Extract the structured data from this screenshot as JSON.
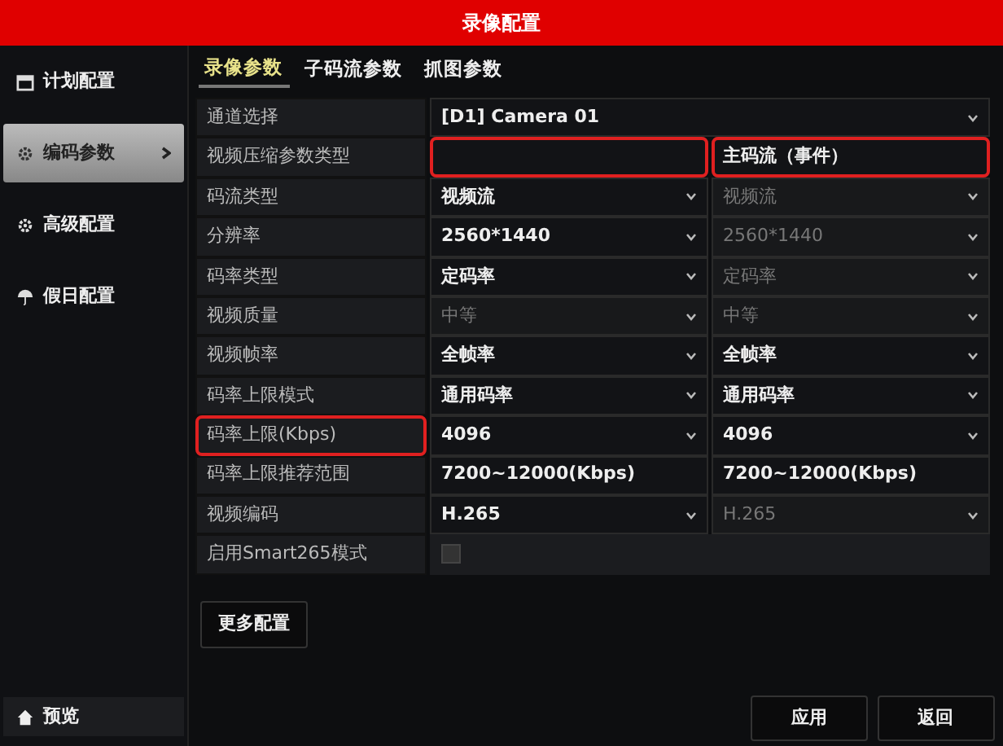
{
  "window": {
    "title": "录像配置"
  },
  "sidebar": {
    "items": [
      {
        "label": "计划配置",
        "selected": false
      },
      {
        "label": "编码参数",
        "selected": true
      },
      {
        "label": "高级配置",
        "selected": false
      },
      {
        "label": "假日配置",
        "selected": false
      }
    ],
    "footer": {
      "label": "预览"
    }
  },
  "tabs": [
    {
      "label": "录像参数",
      "selected": true
    },
    {
      "label": "子码流参数",
      "selected": false
    },
    {
      "label": "抓图参数",
      "selected": false
    }
  ],
  "rows": [
    {
      "label": "通道选择",
      "kind": "wide",
      "values": [
        {
          "text": "[D1] Camera 01",
          "disabled": false
        }
      ]
    },
    {
      "label": "视频压缩参数类型",
      "kind": "text",
      "values": [
        {
          "highlighted": true,
          "disabled": false
        },
        {
          "text": "主码流（事件）",
          "highlighted": true,
          "disabled": false
        }
      ]
    },
    {
      "label": "码流类型",
      "kind": "select",
      "values": [
        {
          "text": "视频流",
          "disabled": false
        },
        {
          "text": "视频流",
          "disabled": true
        }
      ]
    },
    {
      "label": "分辨率",
      "kind": "select",
      "values": [
        {
          "text": "2560*1440",
          "disabled": false
        },
        {
          "text": "2560*1440",
          "disabled": true
        }
      ]
    },
    {
      "label": "码率类型",
      "kind": "select",
      "values": [
        {
          "text": "定码率",
          "disabled": false
        },
        {
          "text": "定码率",
          "disabled": true
        }
      ]
    },
    {
      "label": "视频质量",
      "kind": "select",
      "values": [
        {
          "text": "中等",
          "disabled": true
        },
        {
          "text": "中等",
          "disabled": true
        }
      ]
    },
    {
      "label": "视频帧率",
      "kind": "select",
      "values": [
        {
          "text": "全帧率",
          "disabled": false
        },
        {
          "text": "全帧率",
          "disabled": false
        }
      ]
    },
    {
      "label": "码率上限模式",
      "kind": "select",
      "values": [
        {
          "text": "通用码率",
          "disabled": false
        },
        {
          "text": "通用码率",
          "disabled": false
        }
      ]
    },
    {
      "label": "码率上限(Kbps)",
      "label_highlighted": true,
      "kind": "select",
      "values": [
        {
          "text": "4096",
          "disabled": false
        },
        {
          "text": "4096",
          "disabled": false
        }
      ]
    },
    {
      "label": "码率上限推荐范围",
      "kind": "text",
      "values": [
        {
          "text": "7200~12000(Kbps)",
          "disabled": false
        },
        {
          "text": "7200~12000(Kbps)",
          "disabled": false
        }
      ]
    },
    {
      "label": "视频编码",
      "kind": "select",
      "values": [
        {
          "text": "H.265",
          "disabled": false
        },
        {
          "text": "H.265",
          "disabled": true
        }
      ]
    },
    {
      "label": "启用Smart265模式",
      "kind": "checkbox",
      "checked": false
    }
  ],
  "more_button": "更多配置",
  "buttons": [
    "应用",
    "返回"
  ]
}
